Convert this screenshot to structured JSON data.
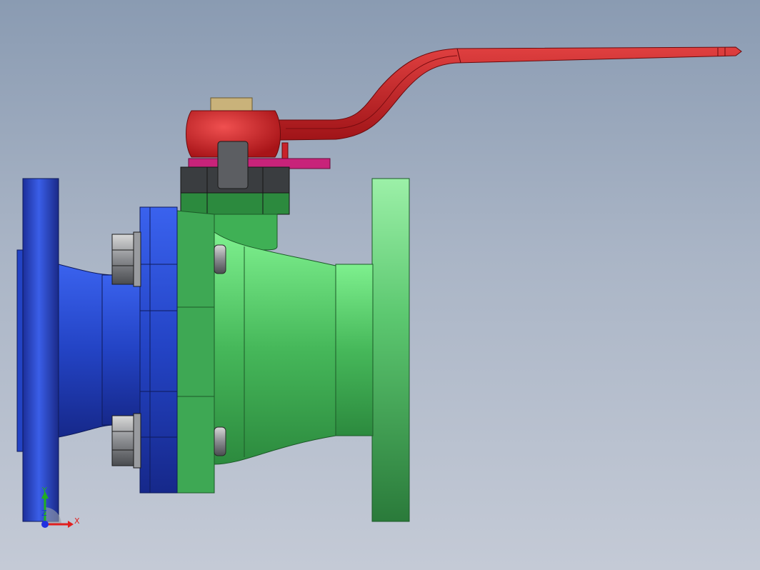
{
  "viewport": {
    "background_top": "#8a9bb2",
    "background_bottom": "#c4cad6"
  },
  "model": {
    "parts": {
      "inlet_flange": {
        "color": "#2747c8"
      },
      "valve_body": {
        "color": "#3fc45a"
      },
      "lever_handle": {
        "color": "#c8232a"
      },
      "stem_nut": {
        "color": "#c9b27a"
      },
      "gland_plate": {
        "color": "#3a3d40"
      },
      "stop_plate": {
        "color": "#c8237a"
      },
      "bolts": {
        "color": "#8a8c90"
      }
    }
  },
  "triad": {
    "y_label": "Y",
    "x_label": "X",
    "z_label": "Z",
    "x_color": "#e02020",
    "y_color": "#20b020",
    "z_color": "#2030e0"
  }
}
